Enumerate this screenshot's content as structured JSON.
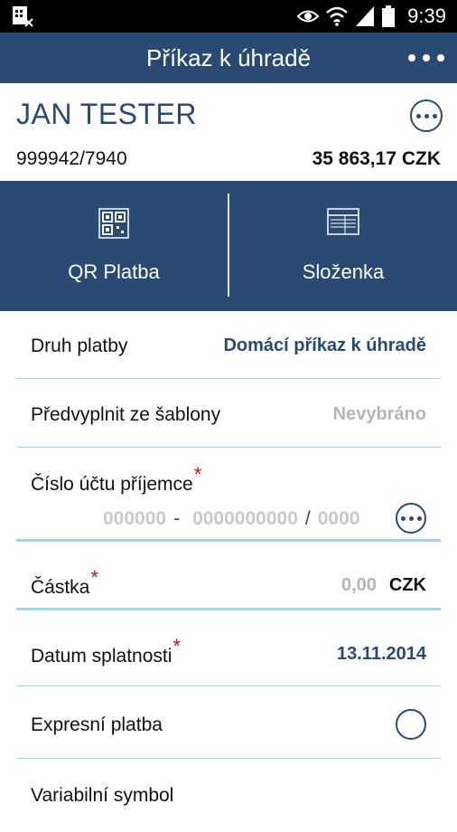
{
  "status_bar": {
    "time": "9:39",
    "icons": [
      "sim-card-icon",
      "eye-icon",
      "wifi-icon",
      "signal-icon",
      "battery-icon"
    ]
  },
  "app_bar": {
    "title": "Příkaz k úhradě",
    "menu_icon": "more-horizontal-icon"
  },
  "account": {
    "name": "JAN TESTER",
    "number": "999942/7940",
    "balance": "35 863,17 CZK"
  },
  "actions": [
    {
      "label": "QR Platba",
      "icon": "qr-code-icon"
    },
    {
      "label": "Složenka",
      "icon": "payment-slip-icon"
    }
  ],
  "form": {
    "payment_type": {
      "label": "Druh platby",
      "value": "Domácí příkaz k úhradě"
    },
    "template": {
      "label": "Předvyplnit ze šablony",
      "value": "Nevybráno"
    },
    "recipient_account": {
      "label": "Číslo účtu příjemce",
      "required": "*",
      "prefix_placeholder": "000000",
      "dash": "-",
      "number_placeholder": "0000000000",
      "slash": "/",
      "bank_code_placeholder": "0000"
    },
    "amount": {
      "label": "Částka",
      "required": "*",
      "placeholder": "0,00",
      "currency": "CZK"
    },
    "due_date": {
      "label": "Datum splatnosti",
      "required": "*",
      "value": "13.11.2014"
    },
    "express": {
      "label": "Expresní platba",
      "checked": false
    },
    "variable_symbol": {
      "label": "Variabilní symbol"
    }
  },
  "colors": {
    "primary": "#284a73",
    "divider": "#9fd6ec",
    "required": "#c1121f",
    "placeholder": "#b5b5b5"
  }
}
